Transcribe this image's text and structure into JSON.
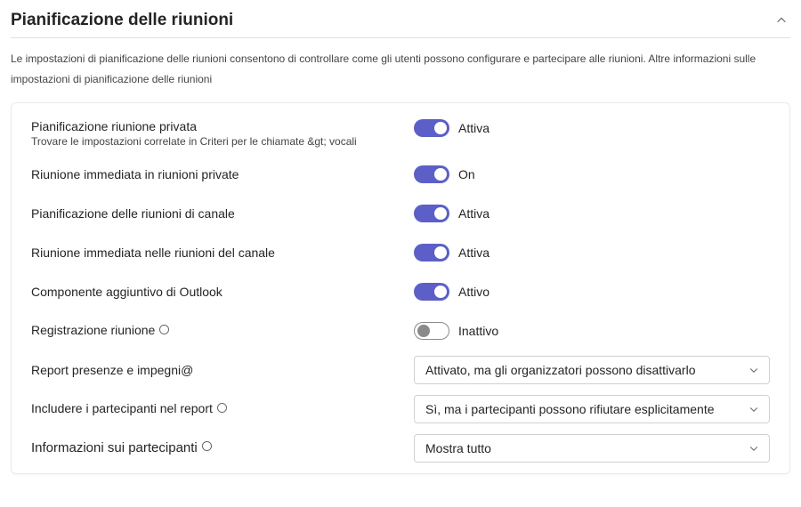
{
  "header": {
    "title": "Pianificazione delle riunioni"
  },
  "description": "Le impostazioni di pianificazione delle riunioni consentono di controllare come gli utenti possono configurare e partecipare alle riunioni. Altre informazioni sulle impostazioni di pianificazione delle riunioni",
  "rows": {
    "privateScheduling": {
      "label": "Pianificazione riunione privata",
      "sub": "Trovare le impostazioni correlate in Criteri per le chiamate &gt; vocali",
      "state": "Attiva"
    },
    "meetNowPrivate": {
      "label": "Riunione immediata in riunioni private",
      "state": "On"
    },
    "channelScheduling": {
      "label": "Pianificazione delle riunioni di canale",
      "state": "Attiva"
    },
    "meetNowChannel": {
      "label": "Riunione immediata nelle riunioni del canale",
      "state": "Attiva"
    },
    "outlookAddin": {
      "label": "Componente aggiuntivo di Outlook",
      "state": "Attivo"
    },
    "registration": {
      "label": "Registrazione riunione",
      "state": "Inattivo"
    },
    "engagementReport": {
      "label": "Report presenze e impegni",
      "value": "Attivato, ma gli organizzatori possono disattivarlo"
    },
    "includeParticipants": {
      "label": "Includere i partecipanti nel report",
      "value": "Sì, ma i partecipanti possono rifiutare esplicitamente"
    },
    "participantInfo": {
      "label": "Informazioni sui partecipanti",
      "value": "Mostra tutto"
    }
  }
}
